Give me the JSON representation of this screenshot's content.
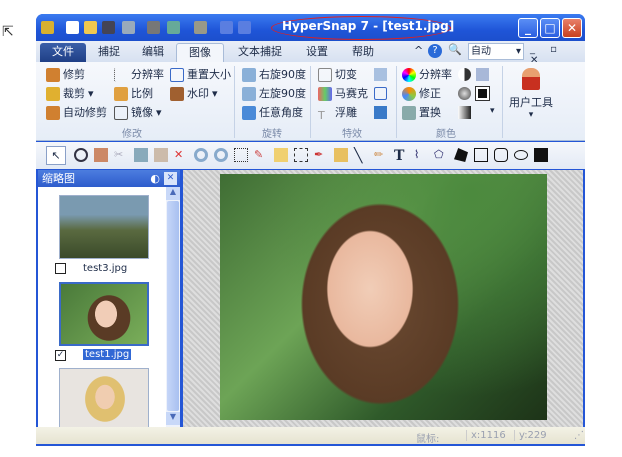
{
  "window": {
    "title": "HyperSnap 7 - [test1.jpg]"
  },
  "tabs": [
    "文件",
    "捕捉",
    "编辑",
    "图像",
    "文本捕捉",
    "设置",
    "帮助"
  ],
  "active_tab": "图像",
  "zoom_select": "自动",
  "ribbon": {
    "modify": {
      "label": "修改",
      "items": [
        "修剪",
        "裁剪",
        "自动修剪",
        "分辨率",
        "比例",
        "镜像",
        "重置大小",
        "水印"
      ]
    },
    "rotate": {
      "label": "旋转",
      "items": [
        "右旋90度",
        "左旋90度",
        "任意角度"
      ]
    },
    "effects": {
      "label": "特效",
      "items": [
        "切变",
        "马赛克",
        "浮雕"
      ]
    },
    "color": {
      "label": "颜色",
      "items": [
        "分辨率",
        "修正",
        "置换"
      ]
    },
    "user_tools": "用户工具"
  },
  "panel": {
    "title": "缩略图",
    "thumbnails": [
      {
        "name": "test3.jpg",
        "checked": false
      },
      {
        "name": "test1.jpg",
        "checked": true
      }
    ]
  },
  "status": {
    "mouse_label": "鼠标:",
    "x": "x:1116",
    "y": "y:229"
  }
}
